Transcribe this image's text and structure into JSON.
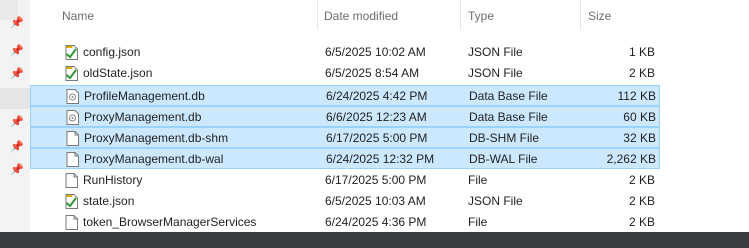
{
  "columns": {
    "name": "Name",
    "date": "Date modified",
    "type": "Type",
    "size": "Size"
  },
  "files": [
    {
      "name": "config.json",
      "date": "6/5/2025 10:02 AM",
      "type": "JSON File",
      "size": "1 KB",
      "icon": "json-file-icon",
      "selected": false
    },
    {
      "name": "oldState.json",
      "date": "6/5/2025 8:54 AM",
      "type": "JSON File",
      "size": "2 KB",
      "icon": "json-file-icon",
      "selected": false
    },
    {
      "name": "ProfileManagement.db",
      "date": "6/24/2025 4:42 PM",
      "type": "Data Base File",
      "size": "112 KB",
      "icon": "db-file-icon",
      "selected": true
    },
    {
      "name": "ProxyManagement.db",
      "date": "6/6/2025 12:23 AM",
      "type": "Data Base File",
      "size": "60 KB",
      "icon": "db-file-icon",
      "selected": true
    },
    {
      "name": "ProxyManagement.db-shm",
      "date": "6/17/2025 5:00 PM",
      "type": "DB-SHM File",
      "size": "32 KB",
      "icon": "blank-file-icon",
      "selected": true
    },
    {
      "name": "ProxyManagement.db-wal",
      "date": "6/24/2025 12:32 PM",
      "type": "DB-WAL File",
      "size": "2,262 KB",
      "icon": "blank-file-icon",
      "selected": true
    },
    {
      "name": "RunHistory",
      "date": "6/17/2025 5:00 PM",
      "type": "File",
      "size": "2 KB",
      "icon": "blank-file-icon",
      "selected": false
    },
    {
      "name": "state.json",
      "date": "6/5/2025 10:03 AM",
      "type": "JSON File",
      "size": "2 KB",
      "icon": "json-file-icon",
      "selected": false
    },
    {
      "name": "token_BrowserManagerServices",
      "date": "6/24/2025 4:36 PM",
      "type": "File",
      "size": "2 KB",
      "icon": "blank-file-icon",
      "selected": false
    }
  ],
  "colors": {
    "selection": "#cce8ff",
    "selection_border": "#99d1ff"
  }
}
